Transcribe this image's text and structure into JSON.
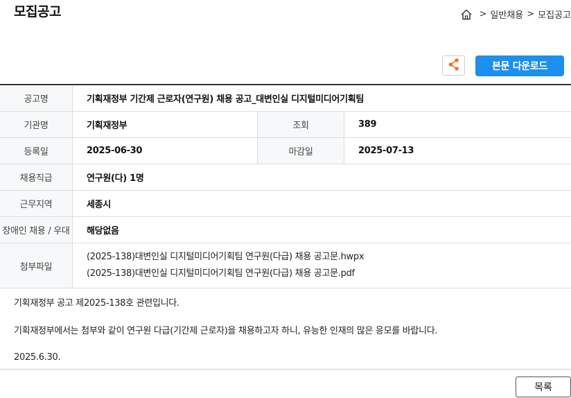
{
  "header": {
    "title": "모집공고",
    "breadcrumb": {
      "home_icon": "home-icon",
      "separator": ">",
      "items": [
        "일반채용",
        "모집공고"
      ]
    }
  },
  "toolbar": {
    "share_icon": "share-icon",
    "download_label": "본문 다운로드"
  },
  "details": {
    "title_label": "공고명",
    "title_value": "기획재정부 기간제 근로자(연구원) 채용 공고_대변인실 디지털미디어기획팀",
    "org_label": "기관명",
    "org_value": "기획재정부",
    "views_label": "조회",
    "views_value": "389",
    "reg_label": "등록일",
    "reg_value": "2025-06-30",
    "deadline_label": "마감일",
    "deadline_value": "2025-07-13",
    "position_label": "채용직급",
    "position_value": "연구원(다) 1명",
    "location_label": "근무지역",
    "location_value": "세종시",
    "disability_label": "장애인 채용 / 우대",
    "disability_value": "해당없음",
    "attach_label": "첨부파일",
    "attachments": [
      "(2025-138)대변인실 디지털미디어기획팀 연구원(다급) 채용 공고문.hwpx",
      "(2025-138)대변인실 디지털미디어기획팀 연구원(다급) 채용 공고문.pdf"
    ]
  },
  "body": {
    "line1": "기획재정부 공고 제2025-138호 관련입니다.",
    "line2": "기획재정부에서는  첨부와 같이 연구원 다급(기간제 근로자)을 채용하고자 하니, 유능한 인재의 많은 응모를 바랍니다.",
    "line3": "2025.6.30."
  },
  "footer": {
    "list_label": "목록"
  },
  "colors": {
    "accent": "#1d8fec",
    "share_icon": "#e8772e"
  }
}
